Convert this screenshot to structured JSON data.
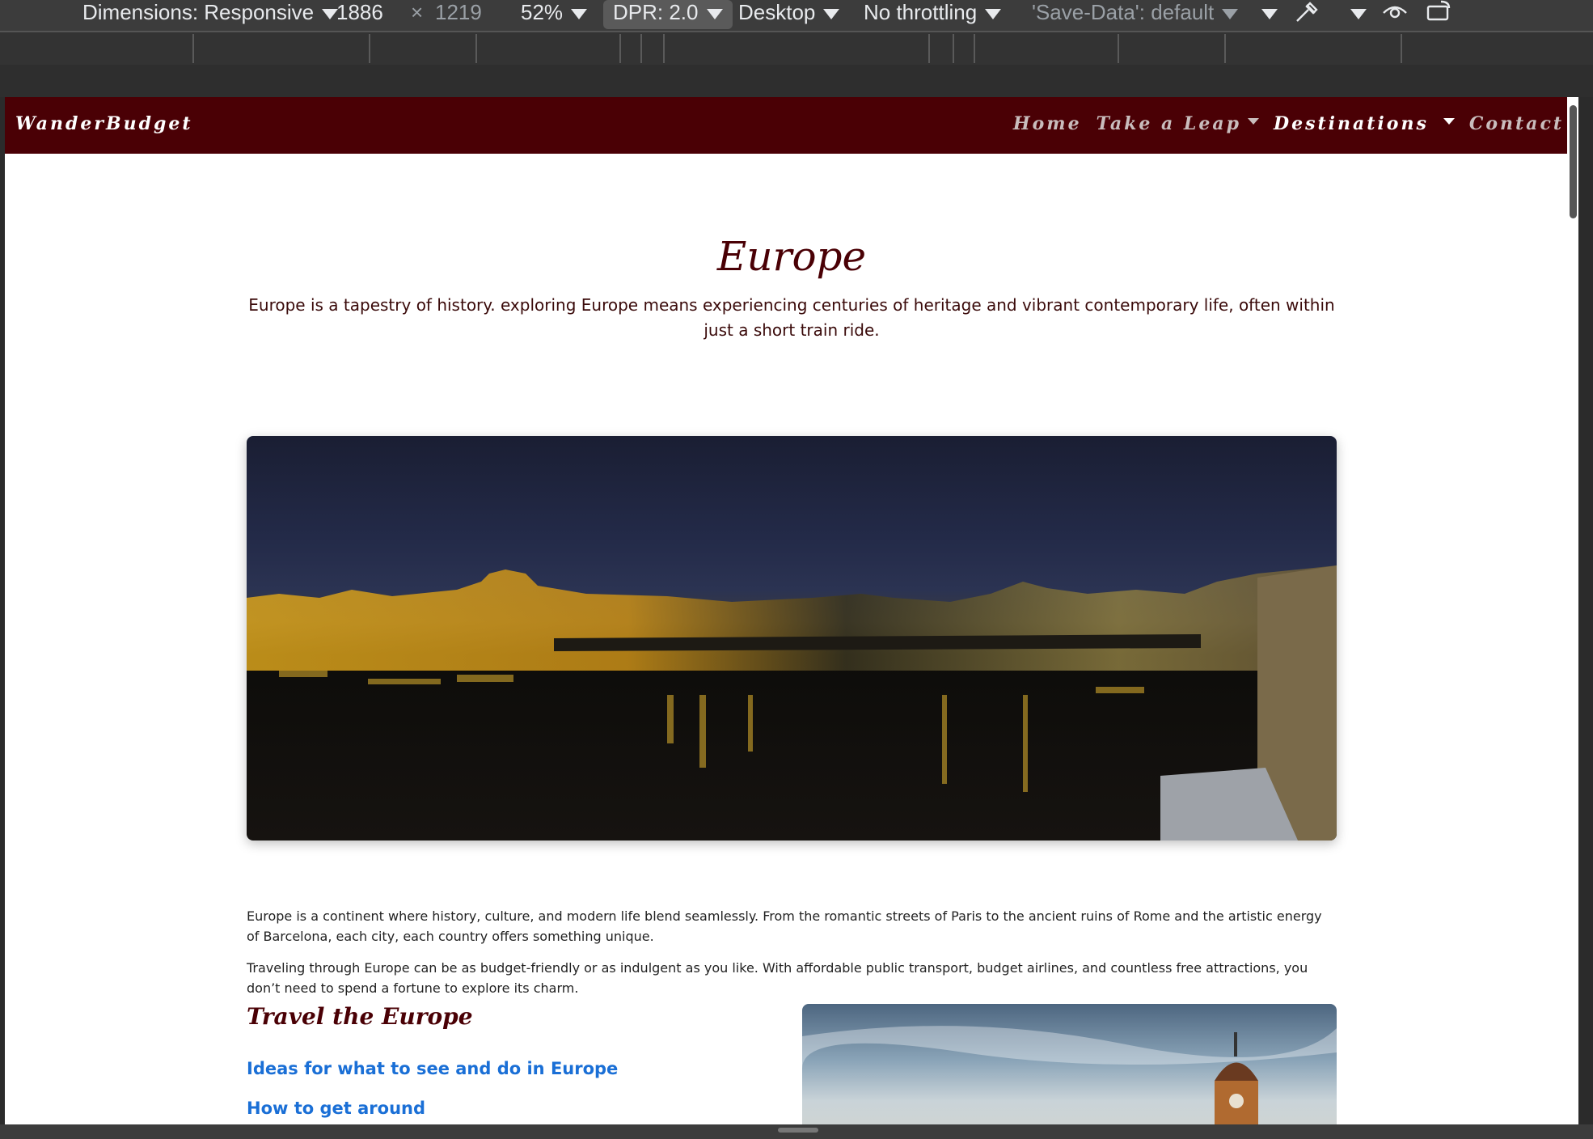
{
  "devtools": {
    "dimensions_label": "Dimensions: Responsive",
    "width": "1886",
    "times": "×",
    "height": "1219",
    "zoom": "52%",
    "dpr": "DPR: 2.0",
    "device_type": "Desktop",
    "throttling": "No throttling",
    "save_data": "'Save-Data': default"
  },
  "site": {
    "brand": "WanderBudget",
    "nav": [
      {
        "label": "Home"
      },
      {
        "label": "Take a Leap"
      },
      {
        "label": "Destinations"
      },
      {
        "label": "Contact"
      }
    ]
  },
  "page": {
    "title": "Europe",
    "lead": "Europe is a tapestry of history. exploring Europe means experiencing centuries of heritage and vibrant contemporary life, often within just a short train ride.",
    "paragraphs": [
      "Europe is a continent where history, culture, and modern life blend seamlessly. From the romantic streets of Paris to the ancient ruins of Rome and the artistic energy of Barcelona, each city, each country offers something unique.",
      "Traveling through Europe can be as budget-friendly or as indulgent as you like. With affordable public transport, budget airlines, and countless free attractions, you don’t need to spend a fortune to explore its charm."
    ],
    "section_title": "Travel the Europe",
    "links": [
      "Ideas for what to see and do in Europe",
      "How to get around"
    ]
  },
  "colors": {
    "navbar": "#4a0005",
    "heading": "#4a0005",
    "link": "#1a6fd6"
  }
}
